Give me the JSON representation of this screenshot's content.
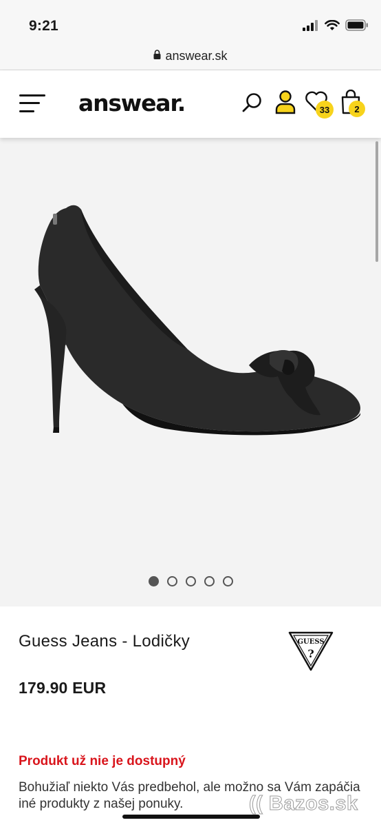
{
  "status_bar": {
    "time": "9:21",
    "icons": [
      "signal-icon",
      "wifi-icon",
      "battery-icon"
    ]
  },
  "browser": {
    "url": "answear.sk",
    "secure_icon": "lock-icon"
  },
  "header": {
    "menu_icon": "hamburger-menu-icon",
    "logo_text": "answear.",
    "icons": [
      "search-icon",
      "user-icon",
      "heart-icon",
      "shopping-bag-icon"
    ],
    "wishlist_count": "33",
    "cart_count": "2",
    "accent_color": "#f7d31c"
  },
  "gallery": {
    "image_subject": "black suede pointed-toe high heel pump with bow",
    "total_slides": 5,
    "active_slide": 1,
    "background_color": "#f3f3f3"
  },
  "product": {
    "name": "Guess Jeans - Lodičky",
    "brand_logo_text": "GUESS",
    "price": "179.90 EUR"
  },
  "availability": {
    "status": "Produkt už nie je dostupný",
    "status_color": "#d9151c",
    "description": "Bohužiaľ niekto Vás predbehol, ale možno sa Vám zapáčia iné produkty z našej ponuky."
  },
  "watermark": {
    "text": "Bazos.sk"
  }
}
